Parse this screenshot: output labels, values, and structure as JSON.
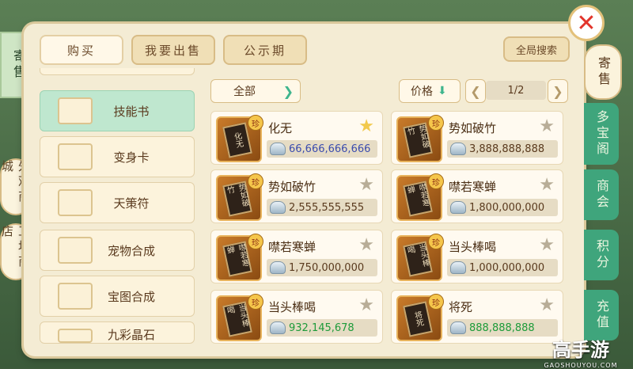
{
  "close_symbol": "✕",
  "left_tab": "寄售",
  "left_side_buttons": [
    "外观商城",
    "工坊商店"
  ],
  "top_tabs": [
    "购买",
    "我要出售",
    "公示期"
  ],
  "global_search": "全局搜索",
  "categories": [
    "技能书",
    "变身卡",
    "天策符",
    "宠物合成",
    "宝图合成",
    "九彩晶石"
  ],
  "filter": {
    "label": "全部"
  },
  "sort": {
    "label": "价格"
  },
  "pagination": {
    "text": "1/2"
  },
  "items": [
    {
      "name": "化无",
      "book_text": "化无",
      "badge": "珍",
      "price": "66,666,666,666",
      "price_color": "#3b4cae",
      "starred": true
    },
    {
      "name": "势如破竹",
      "book_text": "势如破竹",
      "badge": "珍",
      "price": "3,888,888,888",
      "price_color": "#5a3a1e",
      "starred": false
    },
    {
      "name": "势如破竹",
      "book_text": "势如破竹",
      "badge": "珍",
      "price": "2,555,555,555",
      "price_color": "#5a3a1e",
      "starred": false
    },
    {
      "name": "噤若寒蝉",
      "book_text": "噤若寒蝉",
      "badge": "珍",
      "price": "1,800,000,000",
      "price_color": "#5a3a1e",
      "starred": false
    },
    {
      "name": "噤若寒蝉",
      "book_text": "噤若寒蝉",
      "badge": "珍",
      "price": "1,750,000,000",
      "price_color": "#5a3a1e",
      "starred": false
    },
    {
      "name": "当头棒喝",
      "book_text": "当头棒喝",
      "badge": "珍",
      "price": "1,000,000,000",
      "price_color": "#5a3a1e",
      "starred": false
    },
    {
      "name": "当头棒喝",
      "book_text": "当头棒喝",
      "badge": "珍",
      "price": "932,145,678",
      "price_color": "#1d9b3a",
      "starred": false
    },
    {
      "name": "将死",
      "book_text": "将死",
      "badge": "珍",
      "price": "888,888,888",
      "price_color": "#1d9b3a",
      "starred": false
    }
  ],
  "right_tabs": [
    "寄售",
    "多宝阁",
    "商会",
    "积分",
    "充值"
  ],
  "watermark": {
    "brand": "高手游",
    "url": "GAOSHOUYOU.COM"
  },
  "colors": {
    "active_category": "#bfe7cf",
    "accent_green": "#3fb58d",
    "star_gold": "#f2c94c",
    "star_grey": "#b8ad97"
  }
}
